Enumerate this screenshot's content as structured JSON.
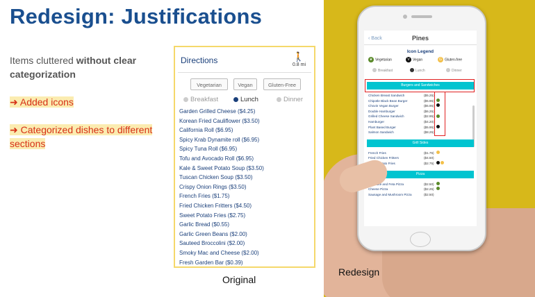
{
  "title": "Redesign: Justifications",
  "intro": {
    "plain": "Items cluttered ",
    "bold": "without clear categorization"
  },
  "bullets": [
    {
      "arrow": "➜",
      "text": "Added icons"
    },
    {
      "arrow": "➜",
      "text": "Categorized dishes to different sections"
    }
  ],
  "original": {
    "caption": "Original",
    "header": "Directions",
    "walk_icon": "walking-person-icon",
    "distance": "0.8 mi",
    "filters": [
      "Vegetarian",
      "Vegan",
      "Gluten-Free"
    ],
    "meals": [
      "Breakfast",
      "Lunch",
      "Dinner"
    ],
    "selected_meal": "Lunch",
    "items": [
      "Garden Grilled Cheese ($4.25)",
      "Korean Fried Cauliflower ($3.50)",
      "California Roll ($6.95)",
      "Spicy Krab Dynamite roll ($6.95)",
      "Spicy Tuna Roll ($6.95)",
      "Tofu and Avocado Roll ($6.95)",
      "Kale & Sweet Potato Soup ($3.50)",
      "Tuscan Chicken Soup ($3.50)",
      "Crispy Onion Rings ($3.50)",
      "French Fries ($1.75)",
      "Fried Chicken Fritters ($4.50)",
      "Sweet Potato Fries ($2.75)",
      "Garlic Bread ($0.55)",
      "Garlic Green Beans ($2.00)",
      "Sauteed Broccolini ($2.00)",
      "Smoky Mac and Cheese ($2.00)",
      "Fresh Garden Bar ($0.39)"
    ]
  },
  "redesign": {
    "caption": "Redesign",
    "back": "Back",
    "screen_title": "Pines",
    "legend_title": "Icon Legend",
    "legend": [
      {
        "label": "Vegetarian",
        "icon": "leaf-icon"
      },
      {
        "label": "Vegan",
        "icon": "vegan-v-icon"
      },
      {
        "label": "Gluten-free",
        "icon": "gluten-free-icon"
      }
    ],
    "meals": [
      "Breakfast",
      "Lunch",
      "Dinner"
    ],
    "selected_meal": "Lunch",
    "sections": [
      {
        "name": "Burgers and Sandwiches",
        "items": [
          {
            "name": "Chicken Breast Sandwich",
            "price": "($5.25)",
            "icons": []
          },
          {
            "name": "Chipotle Black Bean Burger",
            "price": "($5.95)",
            "icons": [
              "veg"
            ]
          },
          {
            "name": "Chovin Vegan Burger",
            "price": "($5.95)",
            "icons": [
              "vegan"
            ]
          },
          {
            "name": "Double Hamburger",
            "price": "($6.25)",
            "icons": []
          },
          {
            "name": "Grilled Cheese Sandwich",
            "price": "($2.95)",
            "icons": [
              "veg"
            ]
          },
          {
            "name": "Hamburger",
            "price": "($4.20)",
            "icons": []
          },
          {
            "name": "Plant Based Burger",
            "price": "($5.95)",
            "icons": [
              "vegan"
            ]
          },
          {
            "name": "Salmon Sandwich",
            "price": "($8.25)",
            "icons": []
          }
        ]
      },
      {
        "name": "Grill Sides",
        "items": [
          {
            "name": "French Fries",
            "price": "($1.75)",
            "icons": [
              "gf"
            ]
          },
          {
            "name": "Fried Chicken Fritters",
            "price": "($4.50)",
            "icons": []
          },
          {
            "name": "Sweet Potato Fries",
            "price": "($2.75)",
            "icons": [
              "vegan",
              "gf"
            ]
          }
        ]
      },
      {
        "name": "Pizza",
        "items": [
          {
            "name": "Artichoke and Feta Pizza",
            "price": "($2.50)",
            "icons": [
              "veg"
            ]
          },
          {
            "name": "Cheese Pizza",
            "price": "($2.25)",
            "icons": [
              "veg"
            ]
          },
          {
            "name": "Sausage and Mushroom Pizza",
            "price": "($2.50)",
            "icons": []
          }
        ]
      }
    ]
  },
  "colors": {
    "title": "#1a4f8f",
    "accent_red": "#d63016",
    "highlight": "#fbecb0",
    "panel_bg": "#d7b81a",
    "section_bar": "#00c4d0"
  }
}
